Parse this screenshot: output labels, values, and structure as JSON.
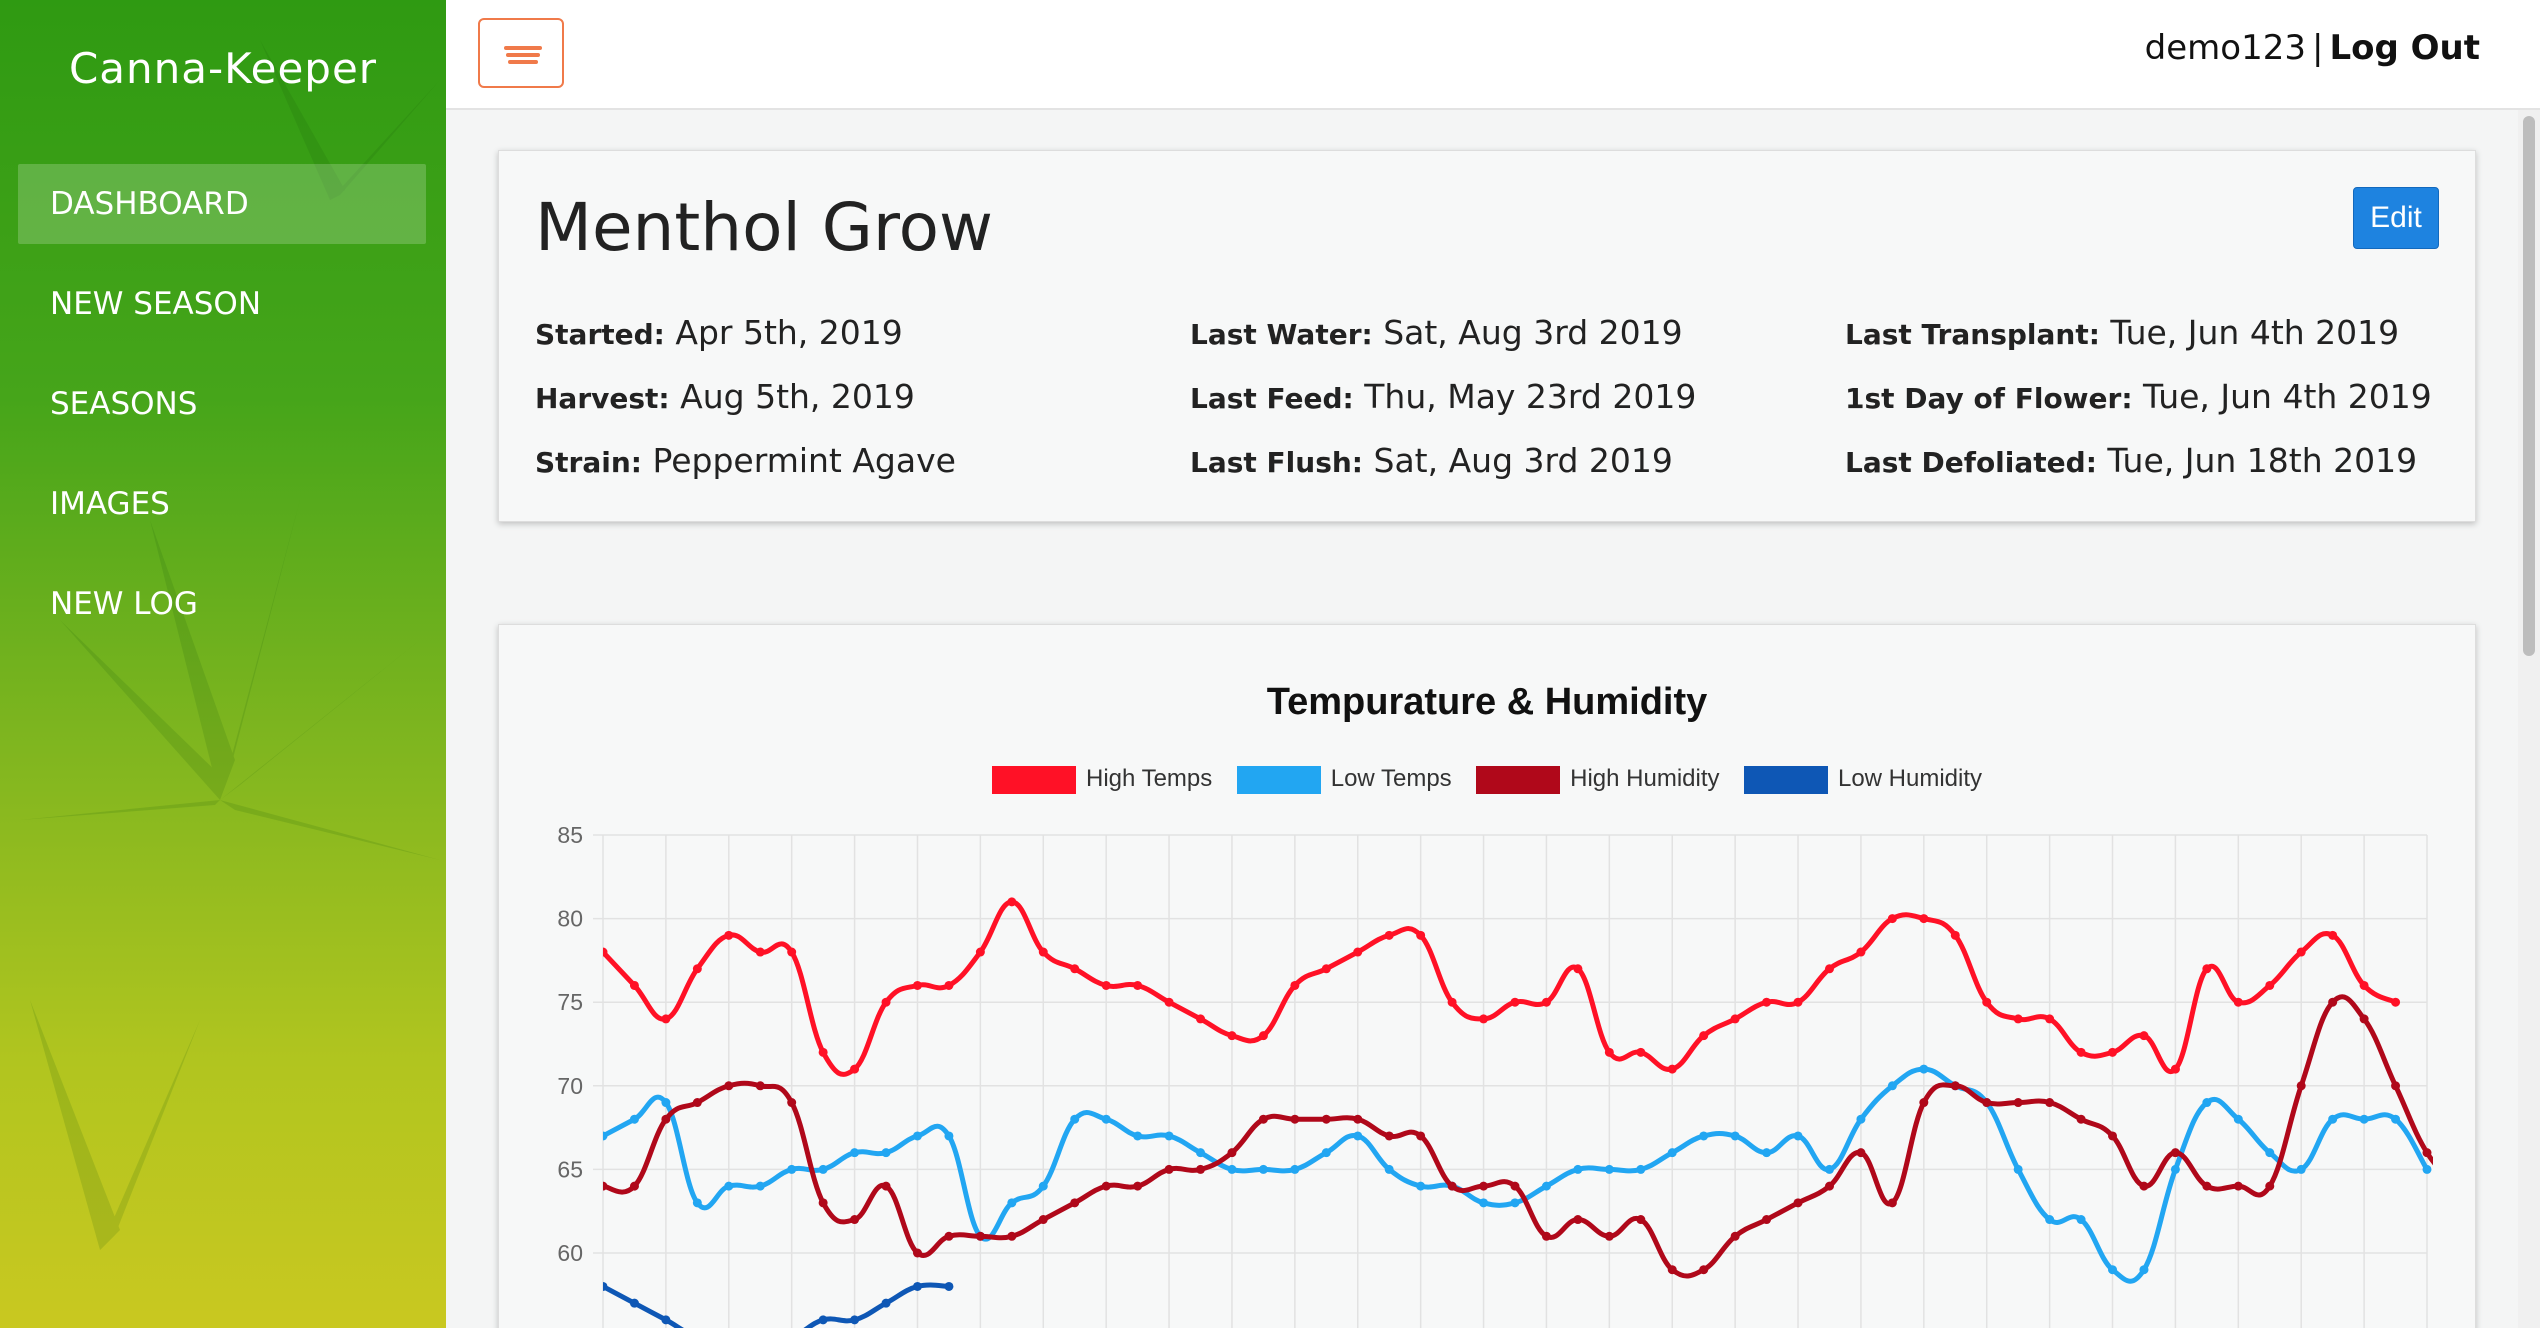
{
  "sidebar": {
    "brand": "Canna-Keeper",
    "items": [
      {
        "label": "DASHBOARD",
        "active": true
      },
      {
        "label": "NEW SEASON",
        "active": false
      },
      {
        "label": "SEASONS",
        "active": false
      },
      {
        "label": "IMAGES",
        "active": false
      },
      {
        "label": "NEW LOG",
        "active": false
      }
    ]
  },
  "header": {
    "menu_icon": "hamburger-menu-icon",
    "username": "demo123",
    "separator": "|",
    "logout_label": "Log Out"
  },
  "grow": {
    "title": "Menthol Grow",
    "edit_label": "Edit",
    "columns": [
      [
        {
          "label": "Started:",
          "value": "Apr 5th, 2019"
        },
        {
          "label": "Harvest:",
          "value": "Aug 5th, 2019"
        },
        {
          "label": "Strain:",
          "value": "Peppermint Agave"
        }
      ],
      [
        {
          "label": "Last Water:",
          "value": "Sat, Aug 3rd 2019"
        },
        {
          "label": "Last Feed:",
          "value": "Thu, May 23rd 2019"
        },
        {
          "label": "Last Flush:",
          "value": "Sat, Aug 3rd 2019"
        }
      ],
      [
        {
          "label": "Last Transplant:",
          "value": "Tue, Jun 4th 2019"
        },
        {
          "label": "1st Day of Flower:",
          "value": "Tue, Jun 4th 2019"
        },
        {
          "label": "Last Defoliated:",
          "value": "Tue, Jun 18th 2019"
        }
      ]
    ]
  },
  "chart_data": {
    "type": "line",
    "title": "Tempurature & Humidity",
    "legend_position": "top",
    "grid": true,
    "ylim": [
      55,
      85
    ],
    "yticks": [
      85,
      80,
      75,
      70,
      65,
      60,
      55
    ],
    "series": [
      {
        "name": "High Temps",
        "color": "#ff1126",
        "values": [
          78,
          76,
          74,
          77,
          79,
          78,
          78,
          72,
          71,
          75,
          76,
          76,
          78,
          81,
          78,
          77,
          76,
          76,
          75,
          74,
          73,
          73,
          76,
          77,
          78,
          79,
          79,
          75,
          74,
          75,
          75,
          77,
          72,
          72,
          71,
          73,
          74,
          75,
          75,
          77,
          78,
          80,
          80,
          79,
          75,
          74,
          74,
          72,
          72,
          73,
          71,
          77,
          75,
          76,
          78,
          79,
          76,
          75
        ]
      },
      {
        "name": "Low Temps",
        "color": "#22a6f2",
        "values": [
          67,
          68,
          69,
          63,
          64,
          64,
          65,
          65,
          66,
          66,
          67,
          67,
          61,
          63,
          64,
          68,
          68,
          67,
          67,
          66,
          65,
          65,
          65,
          66,
          67,
          65,
          64,
          64,
          63,
          63,
          64,
          65,
          65,
          65,
          66,
          67,
          67,
          66,
          67,
          65,
          68,
          70,
          71,
          70,
          69,
          65,
          62,
          62,
          59,
          59,
          65,
          69,
          68,
          66,
          65,
          68,
          68,
          68,
          65
        ]
      },
      {
        "name": "High Humidity",
        "color": "#b0081a",
        "values": [
          64,
          64,
          68,
          69,
          70,
          70,
          69,
          63,
          62,
          64,
          60,
          61,
          61,
          61,
          62,
          63,
          64,
          64,
          65,
          65,
          66,
          68,
          68,
          68,
          68,
          67,
          67,
          64,
          64,
          64,
          61,
          62,
          61,
          62,
          59,
          59,
          61,
          62,
          63,
          64,
          66,
          63,
          69,
          70,
          69,
          69,
          69,
          68,
          67,
          64,
          66,
          64,
          64,
          64,
          70,
          75,
          74,
          70,
          66,
          64
        ]
      },
      {
        "name": "Low Humidity",
        "color": "#0e57b5",
        "values": [
          58,
          57,
          56,
          55,
          55,
          55,
          55,
          56,
          56,
          57,
          58,
          58
        ]
      }
    ]
  }
}
